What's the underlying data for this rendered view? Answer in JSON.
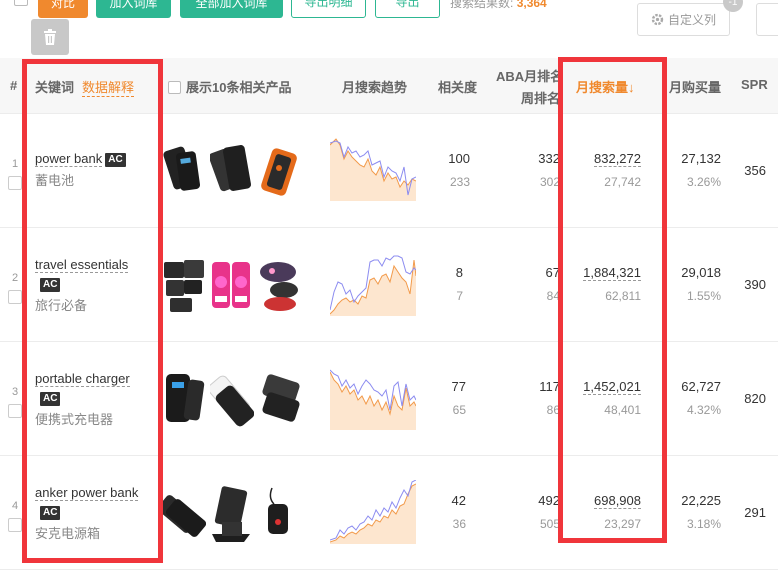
{
  "toolbar": {
    "btn_compare": "对比",
    "btn_add_lib": "加入词库",
    "btn_add_all": "全部加入词库",
    "btn_export_detail": "导出明细",
    "btn_export": "导出",
    "result_label": "搜索结果数:",
    "result_count": "3,364",
    "custom_columns": "自定义列",
    "side_badge": "-1"
  },
  "table": {
    "headers": {
      "index": "#",
      "keyword": "关键词",
      "data_explain": "数据解释",
      "show_products": "展示10条相关产品",
      "trend": "月搜索趋势",
      "relevance": "相关度",
      "aba_line1": "ABA月排名",
      "aba_line2": "周排名",
      "monthly_search": "月搜索量↓",
      "monthly_purchase": "月购买量",
      "spr": "SPR"
    },
    "rows": [
      {
        "index": "1",
        "keyword": "power bank",
        "ac": "AC",
        "cn": "蓄电池",
        "relevance": "100",
        "relevance_sub": "233",
        "aba": "332",
        "aba_sub": "302",
        "search": "832,272",
        "search_sub": "27,742",
        "purchase": "27,132",
        "purchase_pct": "3.26%",
        "spr": "356"
      },
      {
        "index": "2",
        "keyword": "travel essentials",
        "ac": "AC",
        "cn": "旅行必备",
        "relevance": "8",
        "relevance_sub": "7",
        "aba": "67",
        "aba_sub": "84",
        "search": "1,884,321",
        "search_sub": "62,811",
        "purchase": "29,018",
        "purchase_pct": "1.55%",
        "spr": "390"
      },
      {
        "index": "3",
        "keyword": "portable charger",
        "ac": "AC",
        "cn": "便携式充电器",
        "relevance": "77",
        "relevance_sub": "65",
        "aba": "117",
        "aba_sub": "86",
        "search": "1,452,021",
        "search_sub": "48,401",
        "purchase": "62,727",
        "purchase_pct": "4.32%",
        "spr": "820"
      },
      {
        "index": "4",
        "keyword": "anker power bank",
        "ac": "AC",
        "cn": "安克电源箱",
        "relevance": "42",
        "relevance_sub": "36",
        "aba": "492",
        "aba_sub": "505",
        "search": "698,908",
        "search_sub": "23,297",
        "purchase": "22,225",
        "purchase_pct": "3.18%",
        "spr": "291"
      }
    ]
  },
  "colors": {
    "accent_orange": "#f0892e",
    "accent_green": "#2db792",
    "highlight_red": "#f0353b",
    "trend_orange": "#f29a4a",
    "trend_blue": "#8c8cf0"
  },
  "icons": [
    "trash-icon",
    "gear-icon"
  ]
}
